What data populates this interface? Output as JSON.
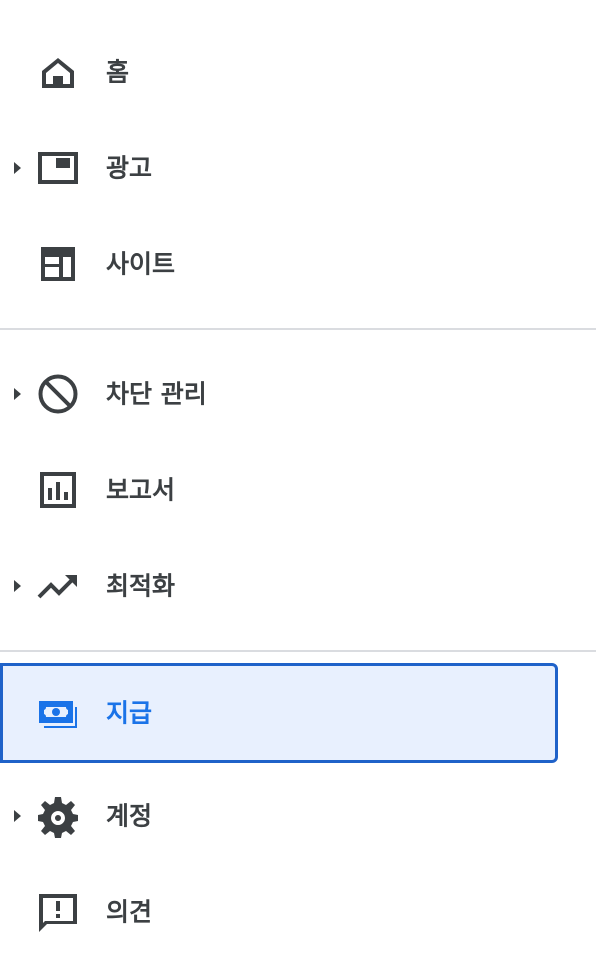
{
  "colors": {
    "text": "#3c4043",
    "icon": "#3c4043",
    "active_text": "#1a73e8",
    "active_background": "#e8f0fe",
    "active_border": "#1f62c9",
    "divider": "#dadce0"
  },
  "nav": {
    "items": [
      {
        "label": "홈",
        "icon": "home-icon",
        "expandable": false,
        "active": false
      },
      {
        "label": "광고",
        "icon": "ads-icon",
        "expandable": true,
        "active": false
      },
      {
        "label": "사이트",
        "icon": "sites-icon",
        "expandable": false,
        "active": false
      },
      {
        "label": "차단 관리",
        "icon": "block-icon",
        "expandable": true,
        "active": false
      },
      {
        "label": "보고서",
        "icon": "reports-icon",
        "expandable": false,
        "active": false
      },
      {
        "label": "최적화",
        "icon": "trending-up-icon",
        "expandable": true,
        "active": false
      },
      {
        "label": "지급",
        "icon": "payments-icon",
        "expandable": false,
        "active": true
      },
      {
        "label": "계정",
        "icon": "gear-icon",
        "expandable": true,
        "active": false
      },
      {
        "label": "의견",
        "icon": "feedback-icon",
        "expandable": false,
        "active": false
      }
    ]
  }
}
